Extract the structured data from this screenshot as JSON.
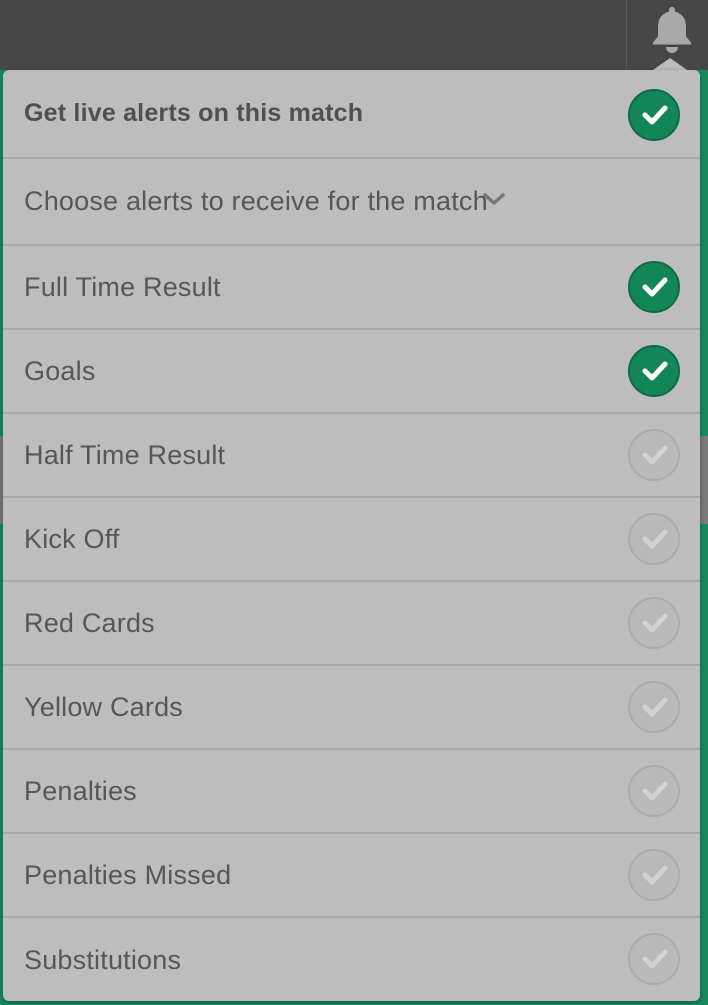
{
  "master_toggle": {
    "label": "Get live alerts on this match",
    "checked": true
  },
  "choose": {
    "label": "Choose alerts to receive for the match",
    "icon": "chevron-down-icon"
  },
  "alerts": [
    {
      "label": "Full Time Result",
      "checked": true
    },
    {
      "label": "Goals",
      "checked": true
    },
    {
      "label": "Half Time Result",
      "checked": false
    },
    {
      "label": "Kick Off",
      "checked": false
    },
    {
      "label": "Red Cards",
      "checked": false
    },
    {
      "label": "Yellow Cards",
      "checked": false
    },
    {
      "label": "Penalties",
      "checked": false
    },
    {
      "label": "Penalties Missed",
      "checked": false
    },
    {
      "label": "Substitutions",
      "checked": false
    }
  ],
  "header": {
    "icon": "bell-icon"
  },
  "colors": {
    "accent": "#138658",
    "panel": "#bdbdbd",
    "topbar": "#474747",
    "text": "#575757"
  }
}
